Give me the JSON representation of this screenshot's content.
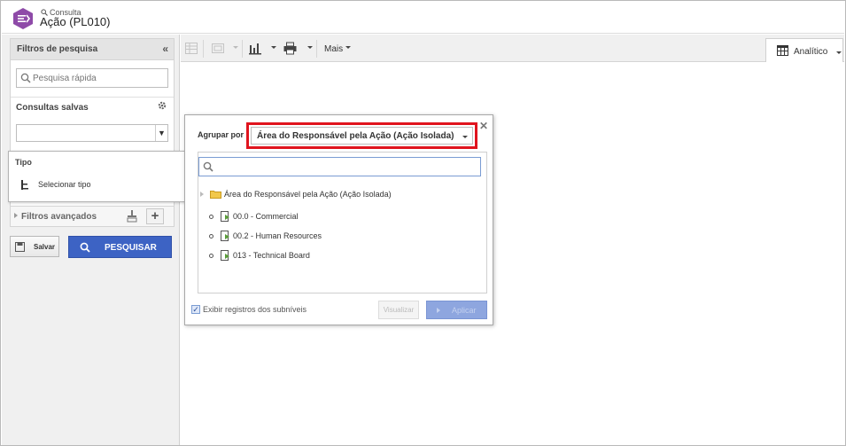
{
  "header": {
    "subtitle": "Consulta",
    "title": "Ação (PL010)",
    "accent": "#8e4aa8"
  },
  "filters": {
    "title": "Filtros de pesquisa",
    "quick_search_placeholder": "Pesquisa rápida",
    "saved_label": "Consultas salvas",
    "saved_value": "",
    "advanced_label": "Filtros avançados",
    "save_label": "Salvar",
    "search_label": "PESQUISAR",
    "search_color": "#3d63c4"
  },
  "tipo_popover": {
    "title": "Tipo",
    "select_label": "Selecionar tipo"
  },
  "toolbar": {
    "more_label": "Mais",
    "view_label": "Analítico"
  },
  "group_dialog": {
    "group_label": "Agrupar por",
    "group_value": "Área do Responsável pela Ação (Ação Isolada)",
    "highlight_color": "#e0141e",
    "search_value": "",
    "root": "Área do Responsável pela Ação (Ação Isolada)",
    "nodes": [
      "00.0 - Commercial",
      "00.2 - Human Resources",
      "013 - Technical Board"
    ],
    "show_sublevels_label": "Exibir registros dos subníveis",
    "show_sublevels_checked": true,
    "view_button": "Visualizar",
    "apply_button": "Aplicar"
  }
}
